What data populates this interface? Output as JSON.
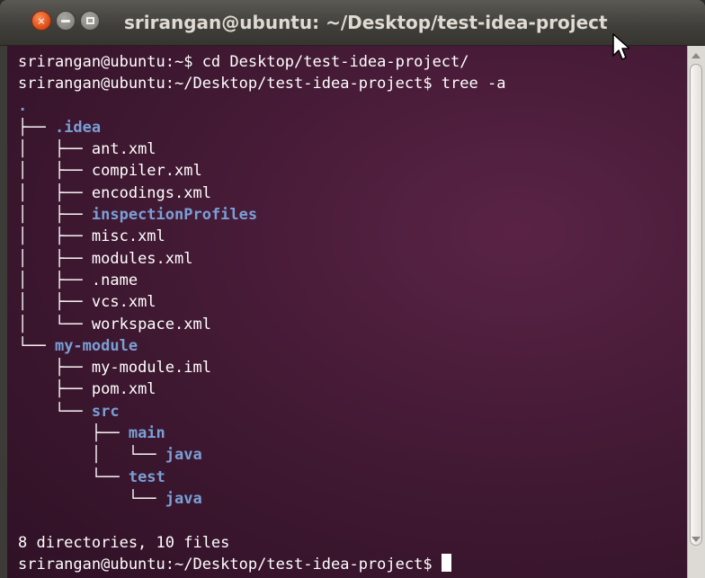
{
  "window": {
    "title": "srirangan@ubuntu: ~/Desktop/test-idea-project",
    "close_glyph": "×"
  },
  "terminal": {
    "lines": [
      {
        "parts": [
          {
            "t": "srirangan@ubuntu:~$ cd Desktop/test-idea-project/",
            "k": "file"
          }
        ]
      },
      {
        "parts": [
          {
            "t": "srirangan@ubuntu:~/Desktop/test-idea-project$ tree -a",
            "k": "file"
          }
        ]
      },
      {
        "parts": [
          {
            "t": ".",
            "k": "dot"
          }
        ]
      },
      {
        "parts": [
          {
            "t": "├── ",
            "k": "glyph"
          },
          {
            "t": ".idea",
            "k": "dir"
          }
        ]
      },
      {
        "parts": [
          {
            "t": "│   ├── ",
            "k": "glyph"
          },
          {
            "t": "ant.xml",
            "k": "file"
          }
        ]
      },
      {
        "parts": [
          {
            "t": "│   ├── ",
            "k": "glyph"
          },
          {
            "t": "compiler.xml",
            "k": "file"
          }
        ]
      },
      {
        "parts": [
          {
            "t": "│   ├── ",
            "k": "glyph"
          },
          {
            "t": "encodings.xml",
            "k": "file"
          }
        ]
      },
      {
        "parts": [
          {
            "t": "│   ├── ",
            "k": "glyph"
          },
          {
            "t": "inspectionProfiles",
            "k": "dir"
          }
        ]
      },
      {
        "parts": [
          {
            "t": "│   ├── ",
            "k": "glyph"
          },
          {
            "t": "misc.xml",
            "k": "file"
          }
        ]
      },
      {
        "parts": [
          {
            "t": "│   ├── ",
            "k": "glyph"
          },
          {
            "t": "modules.xml",
            "k": "file"
          }
        ]
      },
      {
        "parts": [
          {
            "t": "│   ├── ",
            "k": "glyph"
          },
          {
            "t": ".name",
            "k": "file"
          }
        ]
      },
      {
        "parts": [
          {
            "t": "│   ├── ",
            "k": "glyph"
          },
          {
            "t": "vcs.xml",
            "k": "file"
          }
        ]
      },
      {
        "parts": [
          {
            "t": "│   └── ",
            "k": "glyph"
          },
          {
            "t": "workspace.xml",
            "k": "file"
          }
        ]
      },
      {
        "parts": [
          {
            "t": "└── ",
            "k": "glyph"
          },
          {
            "t": "my-module",
            "k": "dir"
          }
        ]
      },
      {
        "parts": [
          {
            "t": "    ├── ",
            "k": "glyph"
          },
          {
            "t": "my-module.iml",
            "k": "file"
          }
        ]
      },
      {
        "parts": [
          {
            "t": "    ├── ",
            "k": "glyph"
          },
          {
            "t": "pom.xml",
            "k": "file"
          }
        ]
      },
      {
        "parts": [
          {
            "t": "    └── ",
            "k": "glyph"
          },
          {
            "t": "src",
            "k": "dir"
          }
        ]
      },
      {
        "parts": [
          {
            "t": "        ├── ",
            "k": "glyph"
          },
          {
            "t": "main",
            "k": "dir"
          }
        ]
      },
      {
        "parts": [
          {
            "t": "        │   └── ",
            "k": "glyph"
          },
          {
            "t": "java",
            "k": "dir"
          }
        ]
      },
      {
        "parts": [
          {
            "t": "        └── ",
            "k": "glyph"
          },
          {
            "t": "test",
            "k": "dir"
          }
        ]
      },
      {
        "parts": [
          {
            "t": "            └── ",
            "k": "glyph"
          },
          {
            "t": "java",
            "k": "dir"
          }
        ]
      },
      {
        "parts": [
          {
            "t": "",
            "k": "file"
          }
        ]
      },
      {
        "parts": [
          {
            "t": "8 directories, 10 files",
            "k": "file"
          }
        ]
      },
      {
        "parts": [
          {
            "t": "srirangan@ubuntu:~/Desktop/test-idea-project$ ",
            "k": "file"
          }
        ],
        "cursor": true
      }
    ]
  },
  "colors": {
    "directory": "#7a9fd6",
    "text": "#ffffff",
    "background": "#3f1831"
  },
  "icons": {
    "close": "close-icon",
    "minimize": "minimize-icon",
    "maximize": "maximize-icon",
    "pointer": "mouse-pointer-icon"
  }
}
